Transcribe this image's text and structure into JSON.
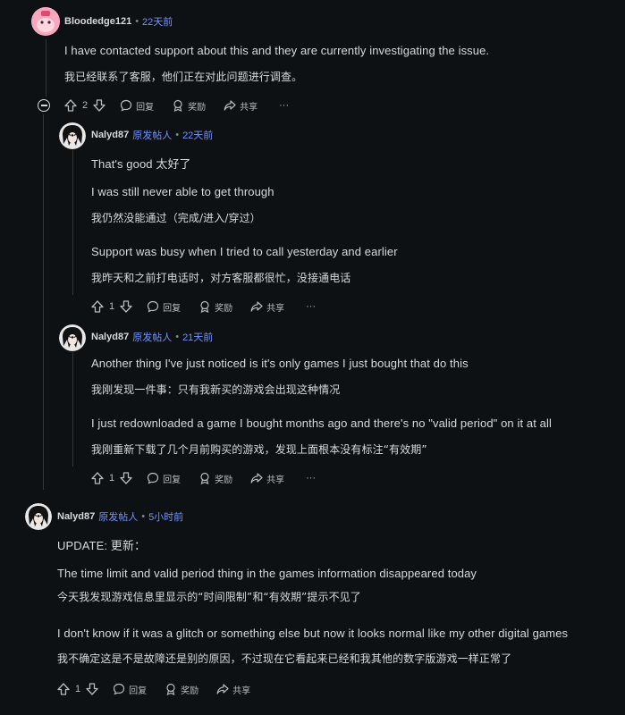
{
  "comments": [
    {
      "author": "Bloodedge121",
      "op_label": "",
      "time": "22天前",
      "lines": [
        "I have contacted support about this and they are currently investigating the issue.",
        "我已经联系了客服，他们正在对此问题进行调查。"
      ],
      "score": "2",
      "actions": {
        "reply": "回复",
        "award": "奖励",
        "share": "共享",
        "more": "···"
      },
      "avatar": "pink-snoo-avatar"
    },
    {
      "author": "Nalyd87",
      "op_label": "原发帖人",
      "time": "22天前",
      "lines": [
        "That's good   太好了",
        "I was still never able to get through",
        "我仍然没能通过（完成/进入/穿过）",
        "Support was busy when I tried to call yesterday and earlier",
        "我昨天和之前打电话时，对方客服都很忙，没接通电话"
      ],
      "score": "1",
      "actions": {
        "reply": "回复",
        "award": "奖励",
        "share": "共享",
        "more": "···"
      },
      "avatar": "dark-haired-character-avatar"
    },
    {
      "author": "Nalyd87",
      "op_label": "原发帖人",
      "time": "21天前",
      "lines": [
        "Another thing I've just noticed is it's only games I just bought that do this",
        "我刚发现一件事：只有我新买的游戏会出现这种情况",
        "I just redownloaded a game I bought months ago and there's no \"valid period\" on it at all",
        "我刚重新下载了几个月前购买的游戏，发现上面根本没有标注“有效期”"
      ],
      "score": "1",
      "actions": {
        "reply": "回复",
        "award": "奖励",
        "share": "共享",
        "more": "···"
      },
      "avatar": "dark-haired-character-avatar"
    },
    {
      "author": "Nalyd87",
      "op_label": "原发帖人",
      "time": "5小时前",
      "lines": [
        "UPDATE:   更新：",
        "The time limit and valid period thing in the games information disappeared today",
        "今天我发现游戏信息里显示的“时间限制”和“有效期”提示不见了",
        "I don't know if it was a glitch or something else but now it looks normal like my other digital games",
        "我不确定这是不是故障还是别的原因，不过现在它看起来已经和我其他的数字版游戏一样正常了"
      ],
      "score": "1",
      "actions": {
        "reply": "回复",
        "award": "奖励",
        "share": "共享",
        "more": ""
      },
      "avatar": "dark-haired-character-avatar"
    }
  ],
  "colors": {
    "background": "#0e1113",
    "op_blue": "#7193ff",
    "text": "#d7dadc",
    "thread_line": "#343536"
  }
}
